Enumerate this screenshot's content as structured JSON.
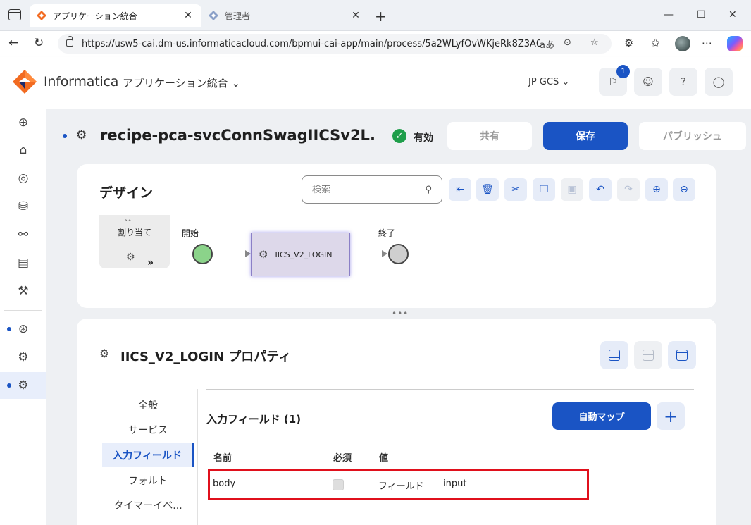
{
  "browser": {
    "tabs": [
      {
        "title": "アプリケーション統合",
        "active": true
      },
      {
        "title": "管理者",
        "active": false
      }
    ],
    "url": "https://usw5-cai.dm-us.informaticacloud.com/bpmui-cai-app/main/process/5a2WLyfOvWKjeRk8Z3A0I5...",
    "reader_label": "aあ"
  },
  "header": {
    "brand": "Informatica",
    "product": "アプリケーション統合",
    "org": "JP GCS",
    "notification_count": "1"
  },
  "process": {
    "name": "recipe-pca-svcConnSwagIICSv2L...",
    "status": "有効",
    "share_label": "共有",
    "save_label": "保存",
    "publish_label": "パブリッシュ"
  },
  "design": {
    "title": "デザイン",
    "search_placeholder": "検索",
    "palette_label": "割り当て",
    "start_label": "開始",
    "end_label": "終了",
    "service_node_label": "IICS_V2_LOGIN"
  },
  "properties": {
    "title": "IICS_V2_LOGIN プロパティ",
    "tabs": [
      "全般",
      "サービス",
      "入力フィールド",
      "フォルト",
      "タイマーイベ..."
    ],
    "selected_tab": "入力フィールド",
    "section_title": "入力フィールド (1)",
    "auto_map_label": "自動マップ",
    "columns": [
      "名前",
      "必須",
      "値"
    ],
    "rows": [
      {
        "name": "body",
        "required": false,
        "value_type": "フィールド",
        "value": "input"
      }
    ]
  },
  "colors": {
    "accent": "#1a54c4",
    "success": "#1e9e4a",
    "highlight": "#e0101c",
    "start_node": "#8bd38a"
  }
}
